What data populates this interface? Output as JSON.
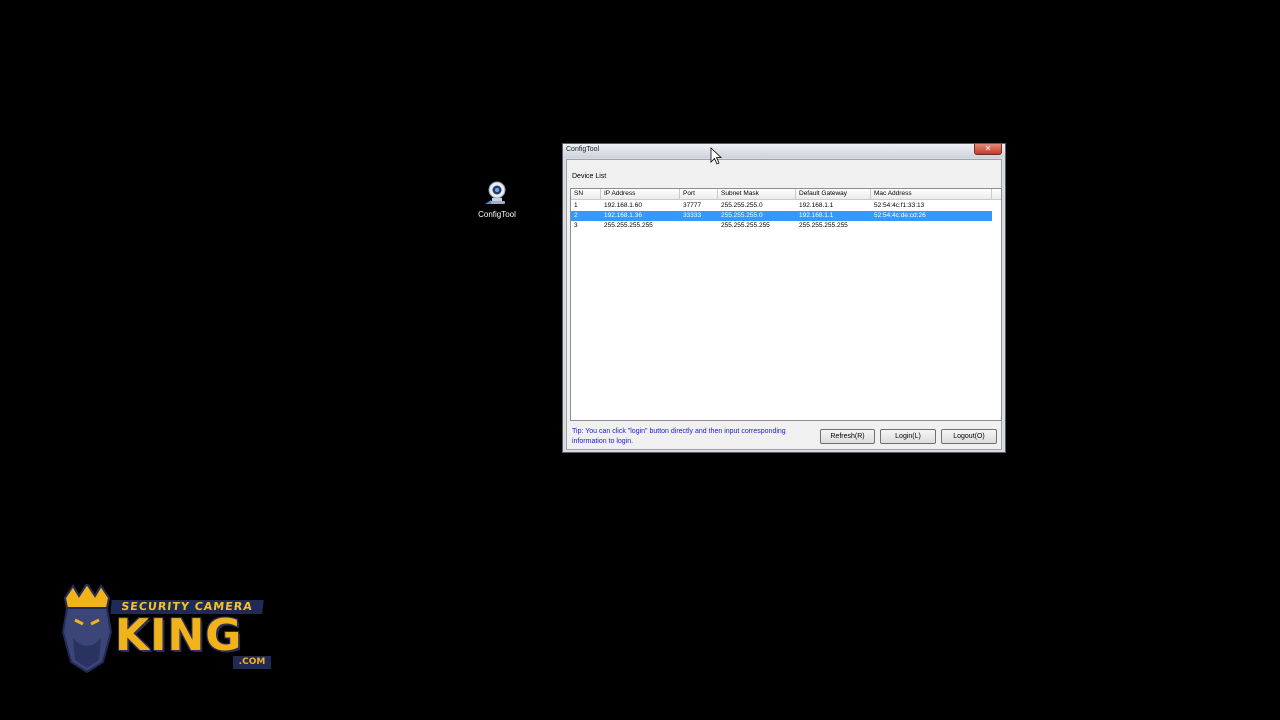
{
  "desktop": {
    "icon_label": "ConfigTool"
  },
  "window": {
    "title": "ConfigTool",
    "close_glyph": "✕",
    "section_label": "Device List",
    "columns": [
      "SN",
      "IP Address",
      "Port",
      "Subnet Mask",
      "Default Gateway",
      "Mac Address"
    ],
    "rows": [
      {
        "sn": "1",
        "ip": "192.168.1.60",
        "port": "37777",
        "mask": "255.255.255.0",
        "gateway": "192.168.1.1",
        "mac": "52:54:4c:f1:33:13",
        "selected": false
      },
      {
        "sn": "2",
        "ip": "192.168.1.36",
        "port": "33333",
        "mask": "255.255.255.0",
        "gateway": "192.168.1.1",
        "mac": "52:54:4c:de:cd:26",
        "selected": true
      },
      {
        "sn": "3",
        "ip": "255.255.255.255",
        "port": "",
        "mask": "255.255.255.255",
        "gateway": "255.255.255.255",
        "mac": "",
        "selected": false
      }
    ],
    "tip": "Tip: You can click \"login\" button directly and then input corresponding information to login.",
    "buttons": {
      "refresh": "Refresh(R)",
      "login": "Login(L)",
      "logout": "Logout(O)"
    }
  },
  "logo": {
    "line1": "SECURITY CAMERA",
    "line2": "KING",
    "line3": ".COM"
  },
  "colors": {
    "selection": "#3399ff",
    "tip_text": "#1a1ad0",
    "logo_gold": "#f2b21a",
    "logo_navy": "#1f2a55"
  }
}
